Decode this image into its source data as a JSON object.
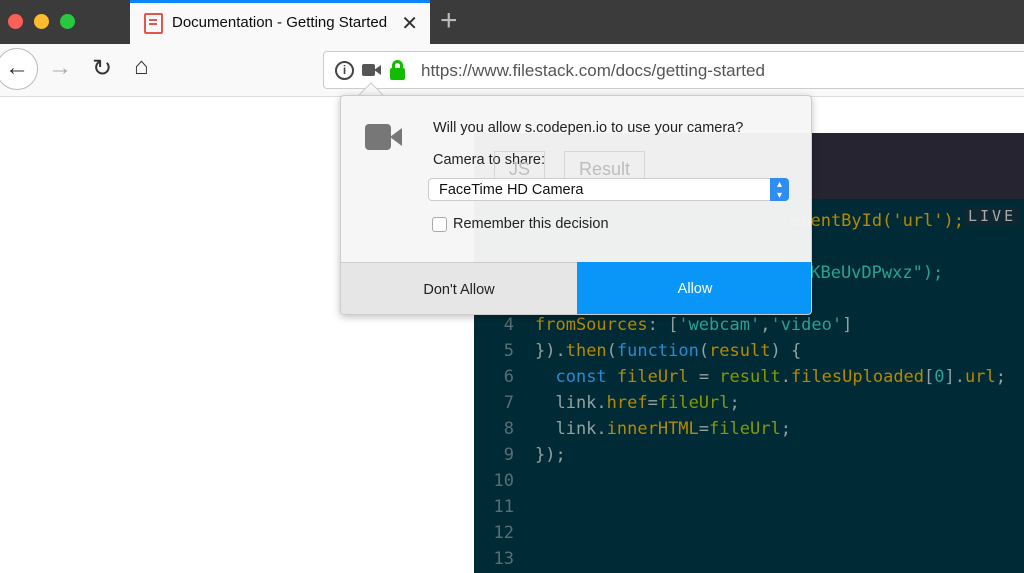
{
  "browser": {
    "tab_title": "Documentation - Getting Started",
    "url": "https://www.filestack.com/docs/getting-started"
  },
  "codepen": {
    "tabs": [
      "JS",
      "Result"
    ],
    "live_label": "LIVE",
    "line_numbers": [
      "4",
      "5",
      "6",
      "7",
      "8",
      "9",
      "10",
      "11",
      "12",
      "13"
    ],
    "line1_fragment": "ementById('url');",
    "line3_fragment": "yKBeUvDPwxz\");"
  },
  "dialog": {
    "question": "Will you allow s.codepen.io to use your camera?",
    "camera_label": "Camera to share:",
    "camera_selected": "FaceTime HD Camera",
    "remember_label": "Remember this decision",
    "remember_checked": false,
    "deny_label": "Don't Allow",
    "allow_label": "Allow"
  },
  "colors": {
    "accent": "#0996f8",
    "lock": "#12bc00",
    "code_bg": "#002b36"
  }
}
